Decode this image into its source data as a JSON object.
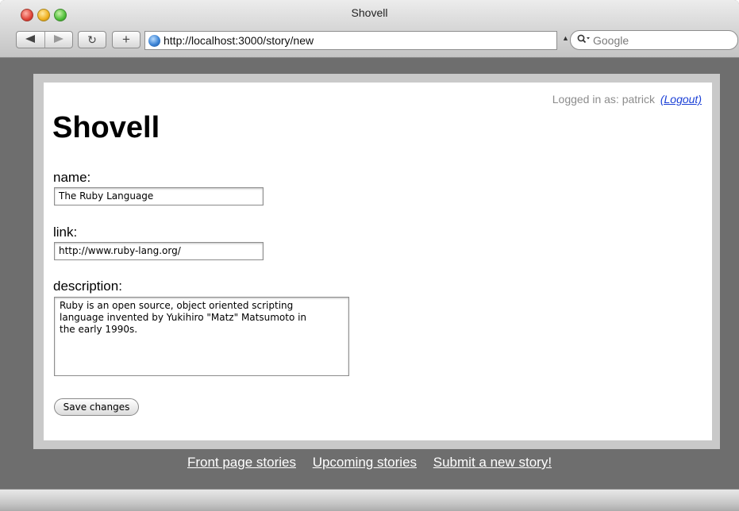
{
  "window": {
    "title": "Shovell"
  },
  "toolbar": {
    "back_icon": "back-arrow-icon",
    "forward_icon": "forward-arrow-icon",
    "reload_glyph": "↻",
    "add_glyph": "+",
    "url": "http://localhost:3000/story/new",
    "search_placeholder": "Google"
  },
  "page": {
    "login_prefix": "Logged in as: patrick",
    "logout_label": "(Logout)",
    "site_title": "Shovell",
    "form": {
      "name_label": "name:",
      "name_value": "The Ruby Language",
      "link_label": "link:",
      "link_value": "http://www.ruby-lang.org/",
      "description_label": "description:",
      "description_value": "Ruby is an open source, object oriented scripting\nlanguage invented by Yukihiro \"Matz\" Matsumoto in\nthe early 1990s.",
      "save_label": "Save changes"
    }
  },
  "footer": {
    "links": [
      "Front page stories",
      "Upcoming stories",
      "Submit a new story!"
    ]
  },
  "colors": {
    "link": "#1a3fd6",
    "chrome_dark": "#6e6e6e"
  }
}
